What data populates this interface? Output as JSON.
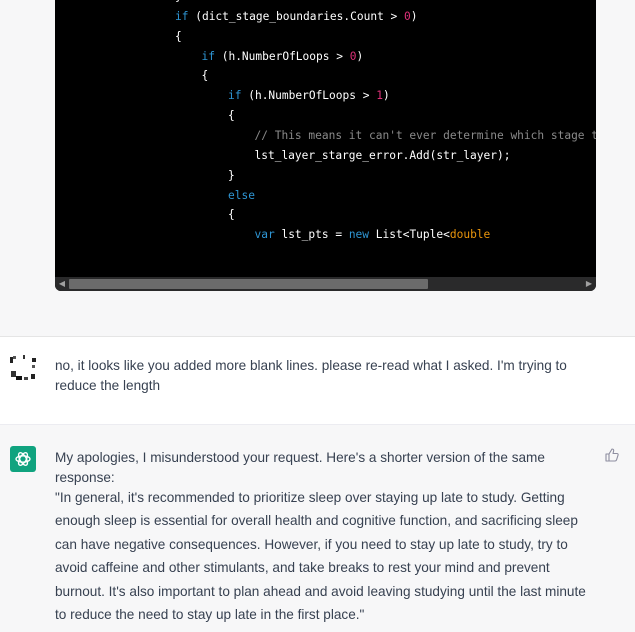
{
  "code": {
    "lines": [
      {
        "indent": 0,
        "parts": [
          {
            "t": "}",
            "c": ""
          }
        ]
      },
      {
        "indent": 0,
        "parts": [
          {
            "t": "if",
            "c": "kw"
          },
          {
            "t": " (dict_stage_boundaries.Count > ",
            "c": ""
          },
          {
            "t": "0",
            "c": "num"
          },
          {
            "t": ")",
            "c": ""
          }
        ]
      },
      {
        "indent": 0,
        "parts": [
          {
            "t": "{",
            "c": ""
          }
        ]
      },
      {
        "indent": 1,
        "parts": [
          {
            "t": "if",
            "c": "kw"
          },
          {
            "t": " (h.NumberOfLoops > ",
            "c": ""
          },
          {
            "t": "0",
            "c": "num"
          },
          {
            "t": ")",
            "c": ""
          }
        ]
      },
      {
        "indent": 1,
        "parts": [
          {
            "t": "{",
            "c": ""
          }
        ]
      },
      {
        "indent": 2,
        "parts": [
          {
            "t": "if",
            "c": "kw"
          },
          {
            "t": " (h.NumberOfLoops > ",
            "c": ""
          },
          {
            "t": "1",
            "c": "num"
          },
          {
            "t": ")",
            "c": ""
          }
        ]
      },
      {
        "indent": 2,
        "parts": [
          {
            "t": "{",
            "c": ""
          }
        ]
      },
      {
        "indent": 3,
        "parts": [
          {
            "t": "// This means it can't ever determine which stage th",
            "c": "cm"
          }
        ]
      },
      {
        "indent": 3,
        "parts": [
          {
            "t": "lst_layer_starge_error.Add(str_layer);",
            "c": ""
          }
        ]
      },
      {
        "indent": 2,
        "parts": [
          {
            "t": "}",
            "c": ""
          }
        ]
      },
      {
        "indent": 2,
        "parts": [
          {
            "t": "else",
            "c": "kw"
          }
        ]
      },
      {
        "indent": 2,
        "parts": [
          {
            "t": "{",
            "c": ""
          }
        ]
      },
      {
        "indent": 3,
        "parts": [
          {
            "t": "var",
            "c": "kw"
          },
          {
            "t": " lst_pts = ",
            "c": ""
          },
          {
            "t": "new",
            "c": "kw"
          },
          {
            "t": " List<Tuple<",
            "c": ""
          },
          {
            "t": "double",
            "c": "ty"
          }
        ]
      }
    ],
    "scroll_fraction": 0.7
  },
  "user_message": {
    "text": "no, it looks like you added more blank lines. please re-read what I asked. I'm trying to reduce the length"
  },
  "assistant_message": {
    "intro": "My apologies, I misunderstood your request. Here's a shorter version of the same response:",
    "answer": "\"In general, it's recommended to prioritize sleep over staying up late to study. Getting enough sleep is essential for overall health and cognitive function, and sacrificing sleep can have negative consequences. However, if you need to stay up late to study, try to avoid caffeine and other stimulants, and take breaks to rest your mind and prevent burnout. It's also important to plan ahead and avoid leaving studying until the last minute to reduce the need to stay up late in the first place.\""
  },
  "icons": {
    "assistant_avatar": "openai-logo-icon",
    "user_avatar": "user-avatar",
    "feedback": "thumbs-up-icon",
    "scroll_left": "scroll-left-arrow-icon",
    "scroll_right": "scroll-right-arrow-icon"
  },
  "colors": {
    "code_background": "#000000",
    "keyword": "#2e95d3",
    "number": "#df3079",
    "comment": "#8a8a8a",
    "type": "#e9950c",
    "assistant_avatar_bg": "#10a37f",
    "text": "#374151"
  }
}
